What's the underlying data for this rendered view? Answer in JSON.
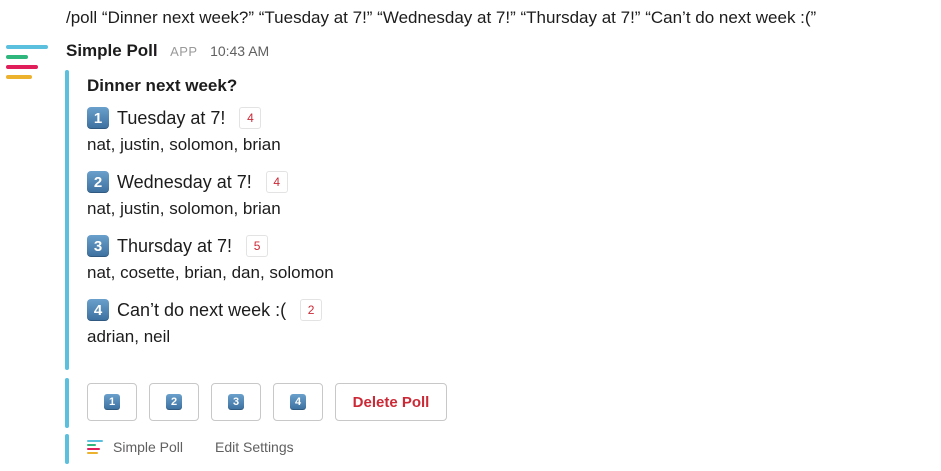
{
  "command": "/poll “Dinner next week?” “Tuesday at 7!” “Wednesday at 7!” “Thursday at 7!” “Can’t do next week :(”",
  "message": {
    "app_name": "Simple Poll",
    "app_badge": "APP",
    "time": "10:43 AM",
    "logo_icon": "simple-poll-logo-icon",
    "accent_color": "#5bc0de"
  },
  "poll": {
    "title": "Dinner next week?",
    "options": [
      {
        "number": "1",
        "label": "Tuesday at 7!",
        "count": "4",
        "voters": "nat, justin, solomon, brian"
      },
      {
        "number": "2",
        "label": "Wednesday at 7!",
        "count": "4",
        "voters": "nat, justin, solomon, brian"
      },
      {
        "number": "3",
        "label": "Thursday at 7!",
        "count": "5",
        "voters": "nat, cosette, brian, dan, solomon"
      },
      {
        "number": "4",
        "label": "Can’t do next week :(",
        "count": "2",
        "voters": "adrian, neil"
      }
    ]
  },
  "buttons": {
    "vote": [
      "1",
      "2",
      "3",
      "4"
    ],
    "delete_label": "Delete Poll"
  },
  "footer": {
    "app_label": "Simple Poll",
    "settings_label": "Edit Settings"
  }
}
